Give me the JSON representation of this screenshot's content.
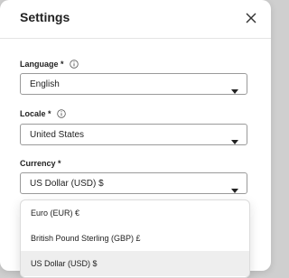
{
  "dialog": {
    "title": "Settings",
    "close_icon": "close-icon"
  },
  "fields": {
    "language": {
      "label": "Language *",
      "value": "English",
      "info_icon": "info-icon"
    },
    "locale": {
      "label": "Locale *",
      "value": "United States",
      "info_icon": "info-icon"
    },
    "currency": {
      "label": "Currency *",
      "value": "US Dollar (USD) $"
    }
  },
  "currency_dropdown": {
    "options": [
      {
        "label": "Euro (EUR) €",
        "selected": false
      },
      {
        "label": "British Pound Sterling (GBP) £",
        "selected": false
      },
      {
        "label": "US Dollar (USD) $",
        "selected": true
      }
    ]
  }
}
